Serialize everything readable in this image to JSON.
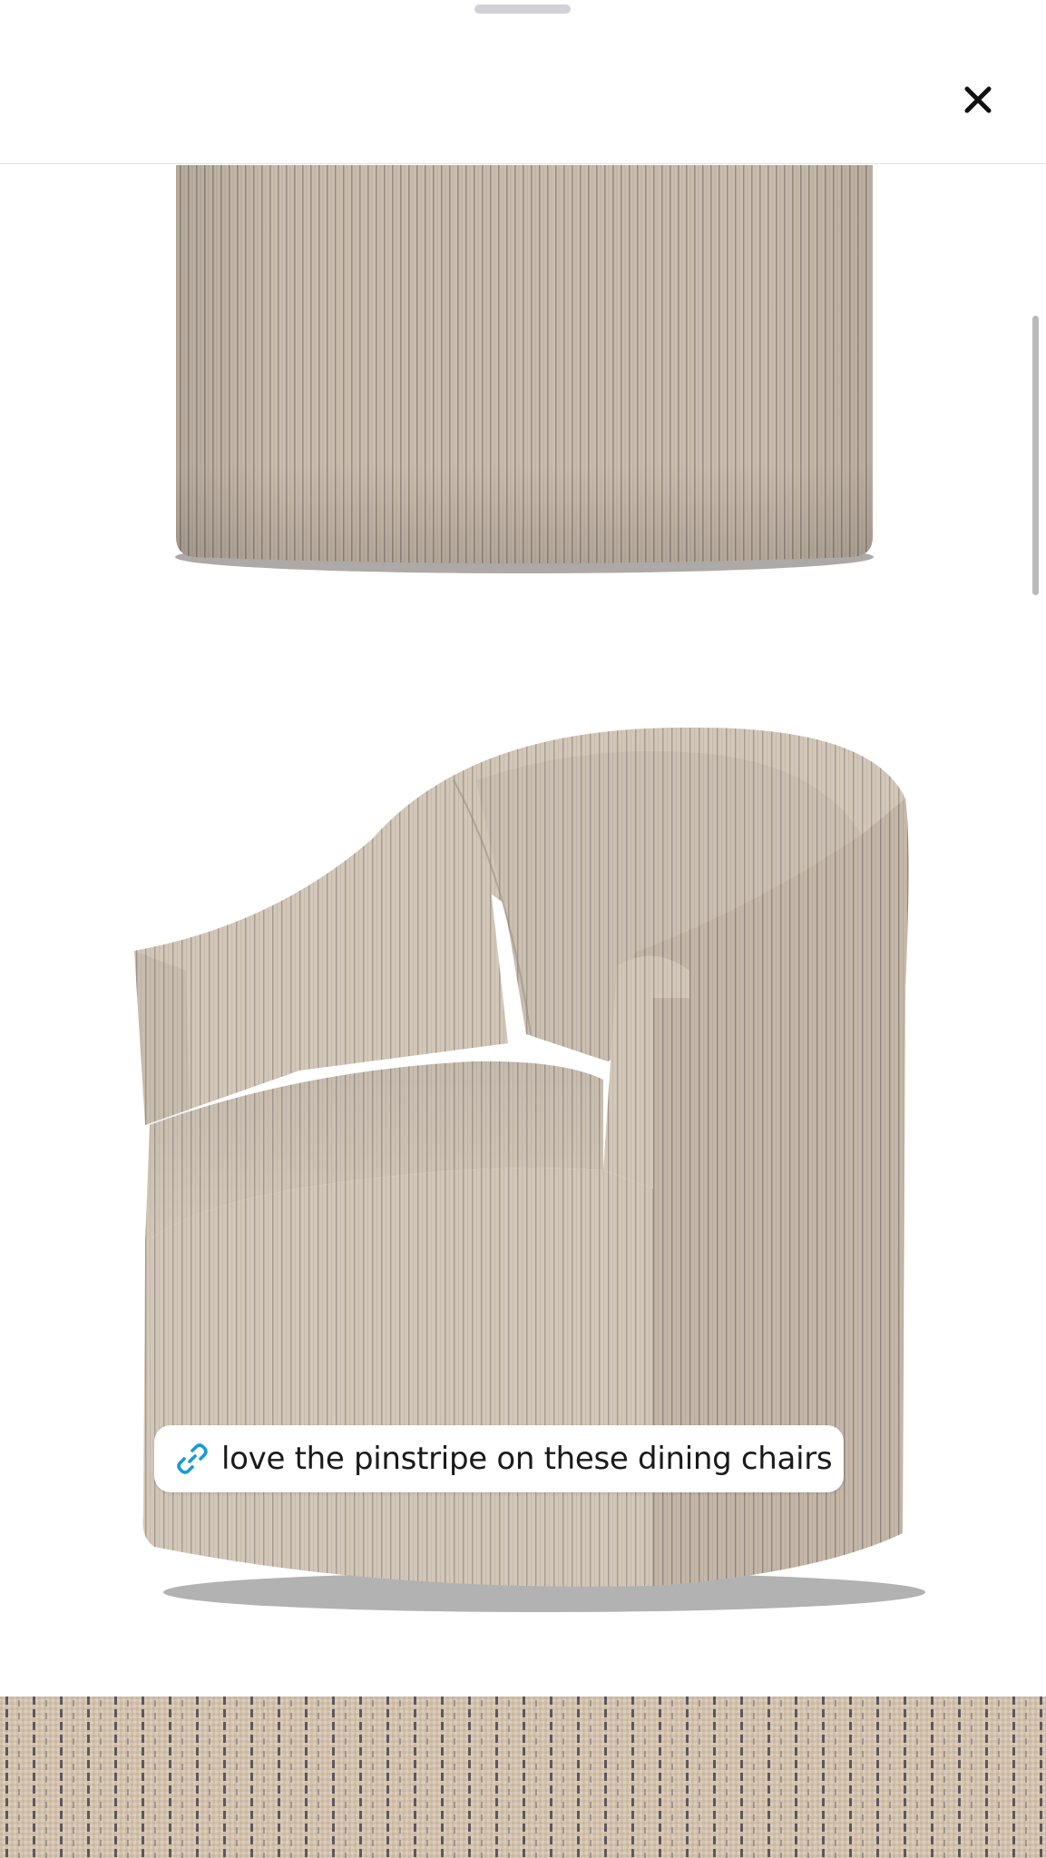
{
  "sheet": {
    "close_icon": "close-icon"
  },
  "gallery": {
    "images": [
      {
        "name": "chair-bottom-image"
      },
      {
        "name": "chair-image"
      },
      {
        "name": "fabric-swatch-image"
      }
    ],
    "caption": {
      "icon": "link-icon",
      "text": "love the pinstripe on these dining chairs"
    }
  },
  "colors": {
    "fabric": "#cdbfb0",
    "fabric_dark": "#b8a99a",
    "stripe": "#5b5550",
    "link_blue": "#1a9ad6"
  }
}
